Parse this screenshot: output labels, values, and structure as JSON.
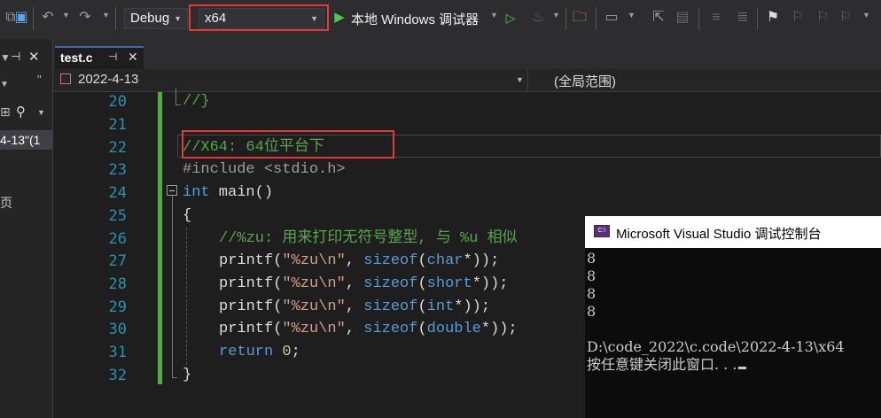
{
  "toolbar": {
    "configuration": "Debug",
    "platform": "x64",
    "run_target": "本地 Windows 调试器"
  },
  "left_panel": {
    "snippet_1": "4-13\"(1",
    "snippet_2": "页"
  },
  "tabs": [
    {
      "label": "test.c",
      "pin": "⊣",
      "close": "✕"
    }
  ],
  "navbar": {
    "file_scope": "2022-4-13",
    "global_scope": "(全局范围)"
  },
  "code": {
    "line_numbers": [
      "20",
      "21",
      "22",
      "23",
      "24",
      "25",
      "26",
      "27",
      "28",
      "29",
      "30",
      "31",
      "32"
    ],
    "line20": "//}",
    "line22": "//X64: 64位平台下",
    "line23": "#include <stdio.h>",
    "line24_kw": "int",
    "line24_rest": " main()",
    "line25": "{",
    "line26": "//%zu: 用来打印无符号整型, 与 %u 相似",
    "printf": "printf",
    "open_paren": "(",
    "fmt": "\"%zu\\n\"",
    "comma": ", ",
    "sizeof": "sizeof",
    "types": [
      "char",
      "short",
      "int",
      "double"
    ],
    "star_close": "*));",
    "return_kw": "return",
    "return_val": "0",
    "semicolon": ";",
    "line32": "}"
  },
  "console": {
    "title": "Microsoft Visual Studio 调试控制台",
    "icon_text": "C:\\",
    "output": [
      "8",
      "8",
      "8",
      "8",
      "",
      "D:\\code_2022\\c.code\\2022-4-13\\x64",
      "按任意键关闭此窗口. . ."
    ]
  },
  "colors": {
    "keyword": "#569cd6",
    "comment": "#57a64a",
    "string": "#d69d85",
    "highlight_box": "#e53935"
  }
}
